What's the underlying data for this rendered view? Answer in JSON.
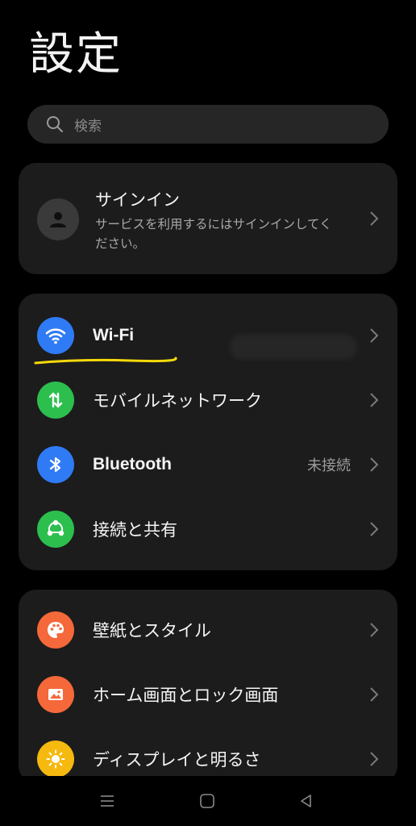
{
  "header": {
    "title": "設定"
  },
  "search": {
    "placeholder": "検索"
  },
  "account": {
    "title": "サインイン",
    "description": "サービスを利用するにはサインインしてください。"
  },
  "network": {
    "items": [
      {
        "label": "Wi-Fi",
        "value": "",
        "icon": "wifi-icon",
        "color": "#2f7bf5"
      },
      {
        "label": "モバイルネットワーク",
        "value": "",
        "icon": "mobile-data-icon",
        "color": "#2cbf4e"
      },
      {
        "label": "Bluetooth",
        "value": "未接続",
        "icon": "bluetooth-icon",
        "color": "#2f7bf5"
      },
      {
        "label": "接続と共有",
        "value": "",
        "icon": "connection-share-icon",
        "color": "#2cbf4e"
      }
    ]
  },
  "personal": {
    "items": [
      {
        "label": "壁紙とスタイル",
        "icon": "palette-icon",
        "color": "#f4683a"
      },
      {
        "label": "ホーム画面とロック画面",
        "icon": "image-icon",
        "color": "#f4683a"
      },
      {
        "label": "ディスプレイと明るさ",
        "icon": "brightness-icon",
        "color": "#f5b90f"
      }
    ]
  },
  "annotation": {
    "color": "#f5d90a"
  },
  "navbar": {
    "buttons": [
      "menu-icon",
      "home-icon",
      "back-icon"
    ]
  }
}
